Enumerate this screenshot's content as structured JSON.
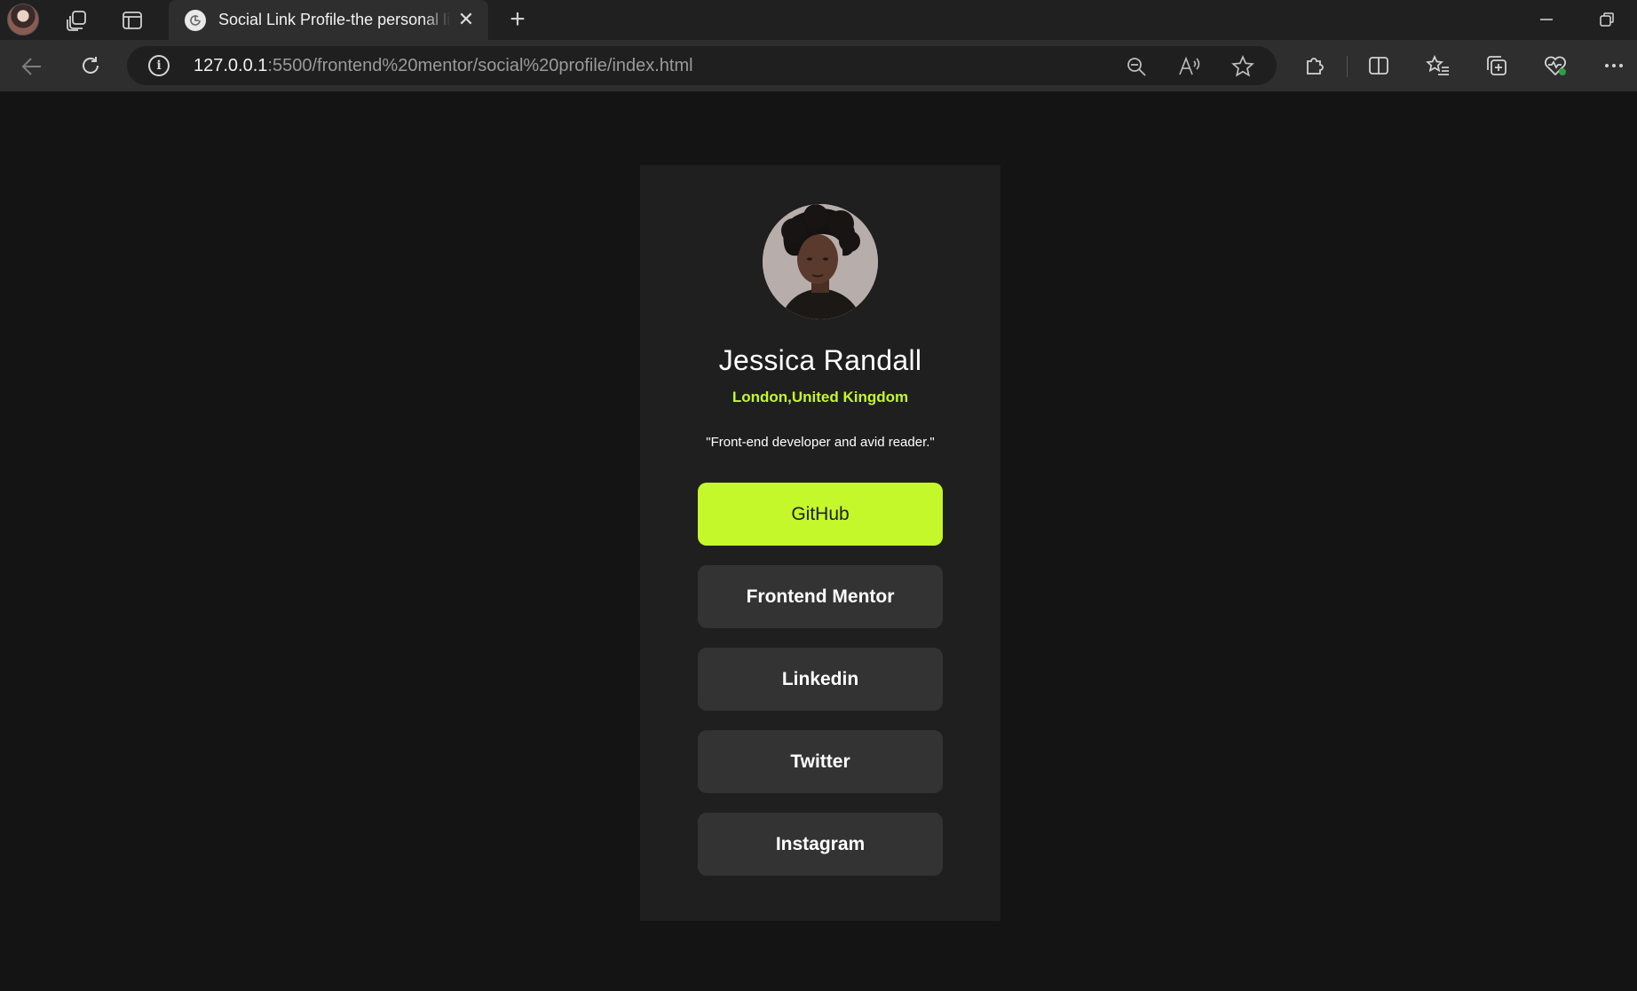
{
  "browser": {
    "tab_title": "Social Link Profile-the personal link page",
    "url_host": "127.0.0.1",
    "url_path": ":5500/frontend%20mentor/social%20profile/index.html",
    "close_glyph": "✕",
    "newtab_glyph": "+",
    "info_glyph": "i"
  },
  "profile": {
    "name": "Jessica Randall",
    "location": "London,United Kingdom",
    "bio": "\"Front-end developer and avid reader.\""
  },
  "links": [
    {
      "label": "GitHub",
      "active": true
    },
    {
      "label": "Frontend Mentor",
      "active": false
    },
    {
      "label": "Linkedin",
      "active": false
    },
    {
      "label": "Twitter",
      "active": false
    },
    {
      "label": "Instagram",
      "active": false
    }
  ],
  "colors": {
    "accent": "#c4f82a",
    "card": "#1f1f1f",
    "button": "#333333",
    "page": "#141414"
  }
}
